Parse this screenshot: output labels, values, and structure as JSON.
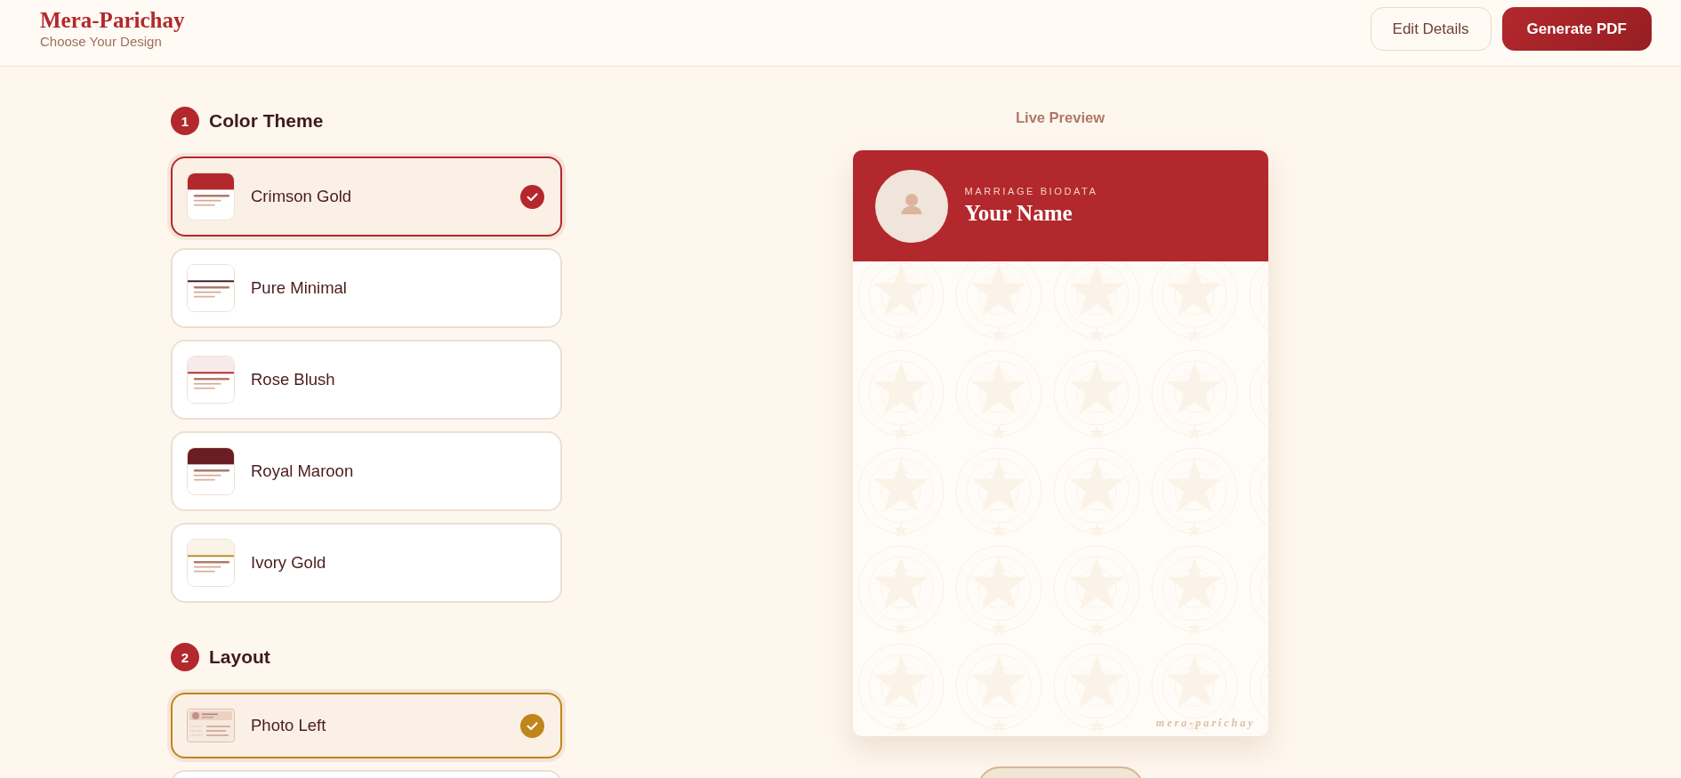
{
  "header": {
    "logo": "Mera-Parichay",
    "subtitle": "Choose Your Design",
    "buttons": [
      {
        "label": "Edit Details",
        "kind": "secondary"
      },
      {
        "label": "Generate PDF",
        "kind": "primary"
      }
    ]
  },
  "sections": [
    {
      "number": "1",
      "title": "Color Theme",
      "kind": "themes",
      "options": [
        {
          "label": "Crimson Gold",
          "selected": true,
          "kind": "band",
          "color": "#b3282d"
        },
        {
          "label": "Pure Minimal",
          "selected": false,
          "kind": "rule",
          "color": "#3d1a1f"
        },
        {
          "label": "Rose Blush",
          "selected": false,
          "kind": "tinted-rule",
          "color": "#b3282d"
        },
        {
          "label": "Royal Maroon",
          "selected": false,
          "kind": "band",
          "color": "#6b1d24"
        },
        {
          "label": "Ivory Gold",
          "selected": false,
          "kind": "tinted-rule",
          "color": "#c0861a"
        }
      ]
    },
    {
      "number": "2",
      "title": "Layout",
      "kind": "layouts",
      "options": [
        {
          "label": "Photo Left",
          "selected": true,
          "kind": "photo-left"
        },
        {
          "selected": false
        }
      ]
    }
  ],
  "preview": {
    "title": "Live Preview",
    "eyebrow": "MARRIAGE BIODATA",
    "name": "Your Name",
    "footer_mark": "mera-parichay"
  }
}
